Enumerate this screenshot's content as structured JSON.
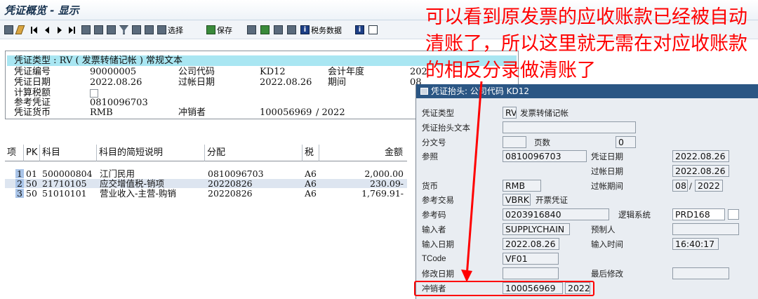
{
  "window": {
    "title": "凭证概览 - 显示"
  },
  "toolbar": {
    "select_label": "选择",
    "save_label": "保存",
    "tax_data_label": "税务数据"
  },
  "header": {
    "doc_type_line": "凭证类型 : RV ( 发票转储记帐 ) 常规文本",
    "doc_number_label": "凭证编号",
    "doc_number_value": "90000005",
    "company_code_label": "公司代码",
    "company_code_value": "KD12",
    "fiscal_year_label": "会计年度",
    "fiscal_year_value": "202",
    "doc_date_label": "凭证日期",
    "doc_date_value": "2022.08.26",
    "posting_date_label": "过帐日期",
    "posting_date_value": "2022.08.26",
    "period_label": "期间",
    "period_value": "08",
    "calc_tax_label": "计算税额",
    "reference_label": "参考凭证",
    "reference_value": "0810096703",
    "currency_label": "凭证货币",
    "currency_value": "RMB",
    "reversed_by_label": "冲销者",
    "reversed_by_value": "100056969",
    "reversed_year": "/ 2022"
  },
  "table": {
    "headers": [
      "项",
      "PK",
      "科目",
      "科目的简短说明",
      "分配",
      "税",
      "金额"
    ],
    "rows": [
      {
        "item": "1",
        "pk": "01",
        "account": "500000804",
        "desc": "江门民用",
        "assign": "0810096703",
        "tax": "A6",
        "amount": "2,000.00"
      },
      {
        "item": "2",
        "pk": "50",
        "account": "21710105",
        "desc": "应交增值税-销项",
        "assign": "20220826",
        "tax": "A6",
        "amount": "230.09-"
      },
      {
        "item": "3",
        "pk": "50",
        "account": "51010101",
        "desc": "营业收入-主营-购销",
        "assign": "20220826",
        "tax": "A6",
        "amount": "1,769.91-"
      }
    ]
  },
  "annotation": {
    "text": "可以看到原发票的应收账款已经被自动清账了，所以这里就无需在对应收账款的相反分录做清账了",
    "color": "#ff0000"
  },
  "popup": {
    "title": "凭证抬头: 公司代码 KD12",
    "doc_type_label": "凭证类型",
    "doc_type_code": "RV",
    "doc_type_text": "发票转储记帐",
    "header_text_label": "凭证抬头文本",
    "header_text_value": "",
    "split_label": "分文号",
    "split_value": "",
    "pages_label": "页数",
    "pages_value": "0",
    "reference_label": "参照",
    "reference_value": "0810096703",
    "doc_date_label": "凭证日期",
    "doc_date_value": "2022.08.26",
    "posting_date_label": "过帐日期",
    "posting_date_value": "2022.08.26",
    "currency_label": "货币",
    "currency_value": "RMB",
    "posting_period_label": "过帐期间",
    "period_value": "08",
    "period_sep": "/",
    "period_year": "2022",
    "ref_txn_label": "参考交易",
    "ref_txn_value": "VBRK",
    "ref_txn_text": "开票凭证",
    "ref_key_label": "参考码",
    "ref_key_value": "0203916840",
    "logical_system_label": "逻辑系统",
    "logical_system_value": "PRD168",
    "entered_by_label": "输入者",
    "entered_by_value": "SUPPLYCHAIN",
    "parked_by_label": "预制人",
    "parked_by_value": "",
    "entry_date_label": "输入日期",
    "entry_date_value": "2022.08.26",
    "entry_time_label": "输入时间",
    "entry_time_value": "16:40:17",
    "tcode_label": "TCode",
    "tcode_value": "VF01",
    "changed_on_label": "修改日期",
    "changed_on_value": "",
    "last_changed_label": "最后修改",
    "last_changed_value": "",
    "reversed_by_label": "冲销者",
    "reversed_by_value": "100056969",
    "reversed_year": "2022"
  }
}
